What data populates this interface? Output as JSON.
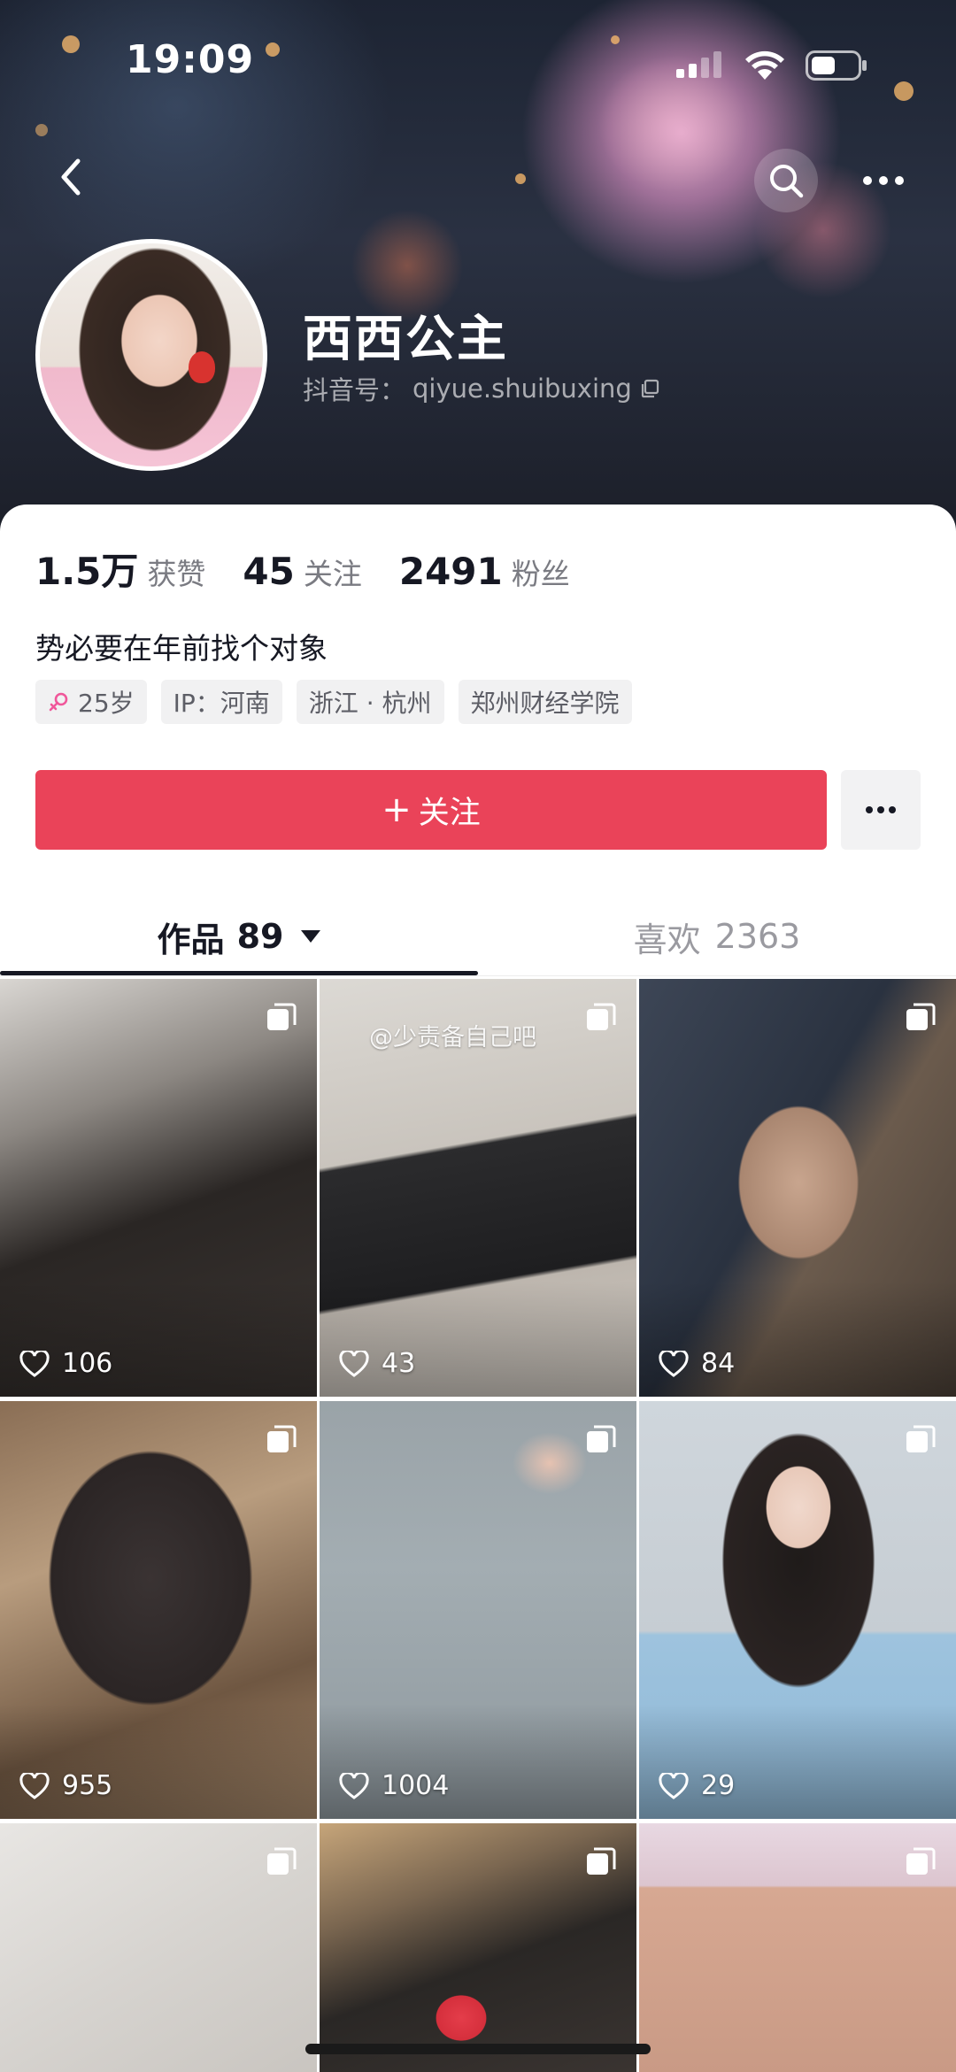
{
  "status_bar": {
    "time": "19:09"
  },
  "profile": {
    "display_name": "西西公主",
    "handle_label": "抖音号：",
    "handle": "qiyue.shuibuxing",
    "bio": "势必要在年前找个对象"
  },
  "stats": [
    {
      "value": "1.5万",
      "label": "获赞"
    },
    {
      "value": "45",
      "label": "关注"
    },
    {
      "value": "2491",
      "label": "粉丝"
    }
  ],
  "tags": {
    "age": "25岁",
    "ip": "IP：河南",
    "location": "浙江 · 杭州",
    "school": "郑州财经学院"
  },
  "actions": {
    "follow_label": "关注"
  },
  "tabs": {
    "works_label": "作品",
    "works_count": "89",
    "likes_label": "喜欢",
    "likes_count": "2363"
  },
  "grid": {
    "tiles": [
      {
        "likes": "106"
      },
      {
        "likes": "43",
        "watermark": "@少责备自己吧"
      },
      {
        "likes": "84"
      },
      {
        "likes": "955"
      },
      {
        "likes": "1004"
      },
      {
        "likes": "29"
      },
      {
        "likes": ""
      },
      {
        "likes": ""
      },
      {
        "likes": ""
      }
    ]
  },
  "colors": {
    "follow_button": "#ea4359",
    "text_primary": "#161823",
    "text_secondary": "#7a7b82",
    "tag_bg": "#f1f1f2"
  },
  "icons": {
    "back": "chevron-left-icon",
    "search": "search-icon",
    "more": "more-horizontal-icon",
    "copy": "copy-icon",
    "gender": "female-icon",
    "multi_image": "multi-image-icon",
    "like": "heart-icon"
  }
}
